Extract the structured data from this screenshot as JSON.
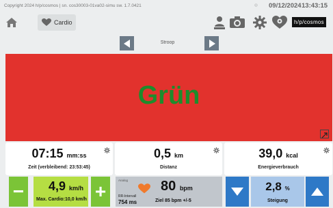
{
  "status": {
    "copyright": "Copyright 2024 h/p/cosmos | sn. cos30003-01va02-simu  sw. 1.7.0421",
    "mini_indicator": "◎",
    "date": "09/12/2024",
    "time": "13:43:15"
  },
  "nav": {
    "mode_button_label": "Cardio",
    "brand": "h/p/cosmos"
  },
  "mode_selector": {
    "label": "Stroop"
  },
  "display": {
    "word": "Grün",
    "background_color": "#e2322d",
    "word_color": "#1e8c2c"
  },
  "stats": {
    "time": {
      "value": "07:15",
      "unit": "mm:ss",
      "label": "Zeit (verbleibend: 23:53:45)"
    },
    "distance": {
      "value": "0,5",
      "unit": "km",
      "label": "Distanz"
    },
    "energy": {
      "value": "39,0",
      "unit": "kcal",
      "label": "Energieverbrauch"
    }
  },
  "speed": {
    "minus": "−",
    "plus": "+",
    "value": "4,9",
    "unit": "km/h",
    "max_label": "Max. Cardio:10,0 km/h"
  },
  "heart_rate": {
    "analog_label": "Analog",
    "rr_label": "RR-Intervall",
    "rr_value": "754 ms",
    "value": "80",
    "unit": "bpm",
    "target_label": "Ziel 85 bpm +/-5"
  },
  "incline": {
    "value": "2,8",
    "unit": "%",
    "label": "Steigung"
  },
  "colors": {
    "green_dark": "#7bc437",
    "green_light": "#b5de43",
    "blue_dark": "#2e79c7",
    "blue_light": "#a9c7e9",
    "heart": "#f07a2c"
  }
}
